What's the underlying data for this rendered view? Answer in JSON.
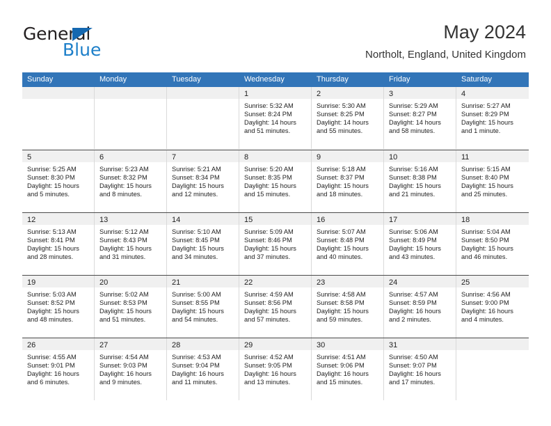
{
  "brand": {
    "name_part1": "General",
    "name_part2": "Blue",
    "triangle_color": "#1568b0",
    "blue_color": "#1d7fc9"
  },
  "header": {
    "title": "May 2024",
    "subtitle": "Northolt, England, United Kingdom"
  },
  "theme": {
    "header_bar_color": "#3275b8",
    "daynum_bar_color": "#f0f0f0",
    "row_divider_color": "#4a4a4a",
    "cell_divider_color": "#d9d9d9"
  },
  "weekdays": [
    "Sunday",
    "Monday",
    "Tuesday",
    "Wednesday",
    "Thursday",
    "Friday",
    "Saturday"
  ],
  "labels": {
    "sunrise_prefix": "Sunrise:",
    "sunset_prefix": "Sunset:",
    "daylight_prefix": "Daylight:"
  },
  "weeks": [
    [
      {
        "day": "",
        "empty": true
      },
      {
        "day": "",
        "empty": true
      },
      {
        "day": "",
        "empty": true
      },
      {
        "day": "1",
        "sunrise": "Sunrise: 5:32 AM",
        "sunset": "Sunset: 8:24 PM",
        "daylight": "Daylight: 14 hours and 51 minutes."
      },
      {
        "day": "2",
        "sunrise": "Sunrise: 5:30 AM",
        "sunset": "Sunset: 8:25 PM",
        "daylight": "Daylight: 14 hours and 55 minutes."
      },
      {
        "day": "3",
        "sunrise": "Sunrise: 5:29 AM",
        "sunset": "Sunset: 8:27 PM",
        "daylight": "Daylight: 14 hours and 58 minutes."
      },
      {
        "day": "4",
        "sunrise": "Sunrise: 5:27 AM",
        "sunset": "Sunset: 8:29 PM",
        "daylight": "Daylight: 15 hours and 1 minute."
      }
    ],
    [
      {
        "day": "5",
        "sunrise": "Sunrise: 5:25 AM",
        "sunset": "Sunset: 8:30 PM",
        "daylight": "Daylight: 15 hours and 5 minutes."
      },
      {
        "day": "6",
        "sunrise": "Sunrise: 5:23 AM",
        "sunset": "Sunset: 8:32 PM",
        "daylight": "Daylight: 15 hours and 8 minutes."
      },
      {
        "day": "7",
        "sunrise": "Sunrise: 5:21 AM",
        "sunset": "Sunset: 8:34 PM",
        "daylight": "Daylight: 15 hours and 12 minutes."
      },
      {
        "day": "8",
        "sunrise": "Sunrise: 5:20 AM",
        "sunset": "Sunset: 8:35 PM",
        "daylight": "Daylight: 15 hours and 15 minutes."
      },
      {
        "day": "9",
        "sunrise": "Sunrise: 5:18 AM",
        "sunset": "Sunset: 8:37 PM",
        "daylight": "Daylight: 15 hours and 18 minutes."
      },
      {
        "day": "10",
        "sunrise": "Sunrise: 5:16 AM",
        "sunset": "Sunset: 8:38 PM",
        "daylight": "Daylight: 15 hours and 21 minutes."
      },
      {
        "day": "11",
        "sunrise": "Sunrise: 5:15 AM",
        "sunset": "Sunset: 8:40 PM",
        "daylight": "Daylight: 15 hours and 25 minutes."
      }
    ],
    [
      {
        "day": "12",
        "sunrise": "Sunrise: 5:13 AM",
        "sunset": "Sunset: 8:41 PM",
        "daylight": "Daylight: 15 hours and 28 minutes."
      },
      {
        "day": "13",
        "sunrise": "Sunrise: 5:12 AM",
        "sunset": "Sunset: 8:43 PM",
        "daylight": "Daylight: 15 hours and 31 minutes."
      },
      {
        "day": "14",
        "sunrise": "Sunrise: 5:10 AM",
        "sunset": "Sunset: 8:45 PM",
        "daylight": "Daylight: 15 hours and 34 minutes."
      },
      {
        "day": "15",
        "sunrise": "Sunrise: 5:09 AM",
        "sunset": "Sunset: 8:46 PM",
        "daylight": "Daylight: 15 hours and 37 minutes."
      },
      {
        "day": "16",
        "sunrise": "Sunrise: 5:07 AM",
        "sunset": "Sunset: 8:48 PM",
        "daylight": "Daylight: 15 hours and 40 minutes."
      },
      {
        "day": "17",
        "sunrise": "Sunrise: 5:06 AM",
        "sunset": "Sunset: 8:49 PM",
        "daylight": "Daylight: 15 hours and 43 minutes."
      },
      {
        "day": "18",
        "sunrise": "Sunrise: 5:04 AM",
        "sunset": "Sunset: 8:50 PM",
        "daylight": "Daylight: 15 hours and 46 minutes."
      }
    ],
    [
      {
        "day": "19",
        "sunrise": "Sunrise: 5:03 AM",
        "sunset": "Sunset: 8:52 PM",
        "daylight": "Daylight: 15 hours and 48 minutes."
      },
      {
        "day": "20",
        "sunrise": "Sunrise: 5:02 AM",
        "sunset": "Sunset: 8:53 PM",
        "daylight": "Daylight: 15 hours and 51 minutes."
      },
      {
        "day": "21",
        "sunrise": "Sunrise: 5:00 AM",
        "sunset": "Sunset: 8:55 PM",
        "daylight": "Daylight: 15 hours and 54 minutes."
      },
      {
        "day": "22",
        "sunrise": "Sunrise: 4:59 AM",
        "sunset": "Sunset: 8:56 PM",
        "daylight": "Daylight: 15 hours and 57 minutes."
      },
      {
        "day": "23",
        "sunrise": "Sunrise: 4:58 AM",
        "sunset": "Sunset: 8:58 PM",
        "daylight": "Daylight: 15 hours and 59 minutes."
      },
      {
        "day": "24",
        "sunrise": "Sunrise: 4:57 AM",
        "sunset": "Sunset: 8:59 PM",
        "daylight": "Daylight: 16 hours and 2 minutes."
      },
      {
        "day": "25",
        "sunrise": "Sunrise: 4:56 AM",
        "sunset": "Sunset: 9:00 PM",
        "daylight": "Daylight: 16 hours and 4 minutes."
      }
    ],
    [
      {
        "day": "26",
        "sunrise": "Sunrise: 4:55 AM",
        "sunset": "Sunset: 9:01 PM",
        "daylight": "Daylight: 16 hours and 6 minutes."
      },
      {
        "day": "27",
        "sunrise": "Sunrise: 4:54 AM",
        "sunset": "Sunset: 9:03 PM",
        "daylight": "Daylight: 16 hours and 9 minutes."
      },
      {
        "day": "28",
        "sunrise": "Sunrise: 4:53 AM",
        "sunset": "Sunset: 9:04 PM",
        "daylight": "Daylight: 16 hours and 11 minutes."
      },
      {
        "day": "29",
        "sunrise": "Sunrise: 4:52 AM",
        "sunset": "Sunset: 9:05 PM",
        "daylight": "Daylight: 16 hours and 13 minutes."
      },
      {
        "day": "30",
        "sunrise": "Sunrise: 4:51 AM",
        "sunset": "Sunset: 9:06 PM",
        "daylight": "Daylight: 16 hours and 15 minutes."
      },
      {
        "day": "31",
        "sunrise": "Sunrise: 4:50 AM",
        "sunset": "Sunset: 9:07 PM",
        "daylight": "Daylight: 16 hours and 17 minutes."
      },
      {
        "day": "",
        "empty": true
      }
    ]
  ]
}
